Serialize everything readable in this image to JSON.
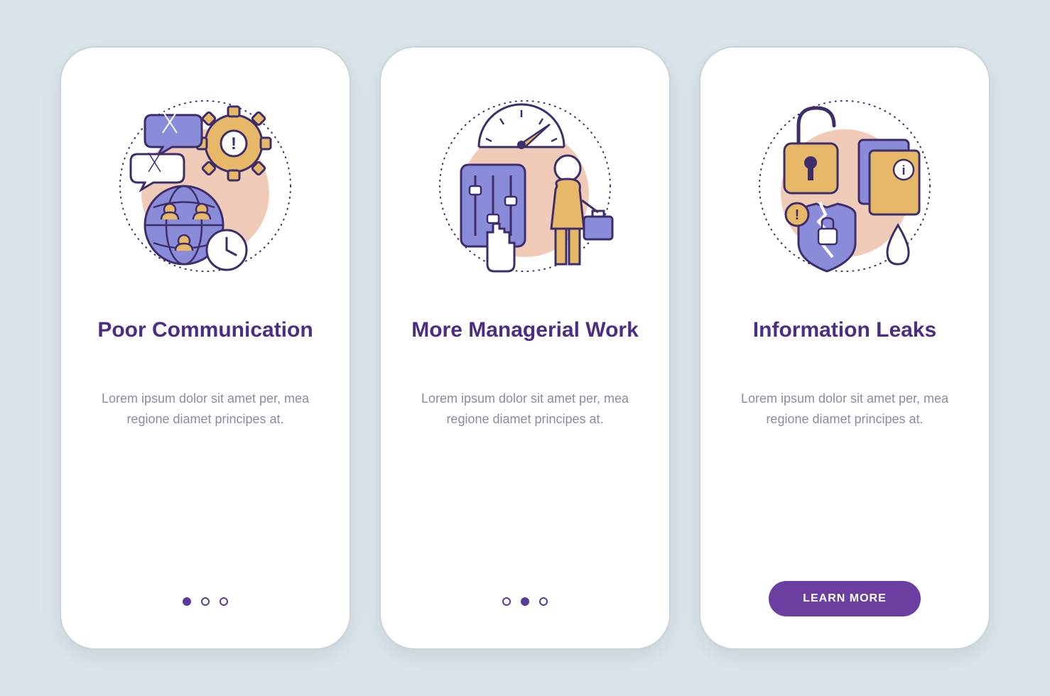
{
  "colors": {
    "bg": "#dae5ea",
    "card": "#ffffff",
    "title": "#4b2e83",
    "body": "#8b8b9e",
    "accent": "#6b3fa0",
    "illu_purple": "#8b8cd9",
    "illu_amber": "#e8b869",
    "illu_peach": "#f0cbb8",
    "illu_stroke": "#3d2e6b"
  },
  "cards": [
    {
      "title": "Poor Communication",
      "body": "Lorem ipsum dolor sit amet per, mea regione diamet principes at.",
      "icon": "poor-communication",
      "active_dot": 0,
      "has_cta": false
    },
    {
      "title": "More Managerial Work",
      "body": "Lorem ipsum dolor sit amet per, mea regione diamet principes at.",
      "icon": "managerial-work",
      "active_dot": 1,
      "has_cta": false
    },
    {
      "title": "Information Leaks",
      "body": "Lorem ipsum dolor sit amet per, mea regione diamet principes at.",
      "icon": "information-leaks",
      "active_dot": 2,
      "has_cta": true
    }
  ],
  "cta_label": "LEARN MORE"
}
